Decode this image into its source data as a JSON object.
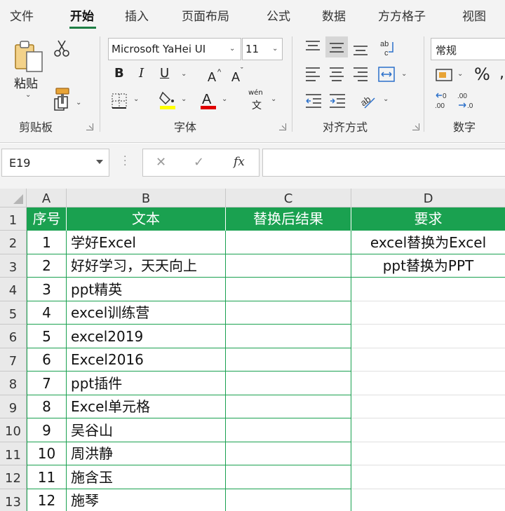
{
  "ribbon": {
    "tabs": [
      "文件",
      "开始",
      "插入",
      "页面布局",
      "公式",
      "数据",
      "方方格子",
      "视图"
    ],
    "active_tab": "开始",
    "groups": {
      "clipboard": "剪贴板",
      "font": "字体",
      "alignment": "对齐方式",
      "number": "数字"
    },
    "paste_label": "粘贴",
    "font_name": "Microsoft YaHei UI",
    "font_size": "11",
    "number_format": "常规",
    "bold": "B",
    "italic": "I",
    "underline": "U",
    "percent": "%",
    "wen_label": "wén",
    "wen_char": "文",
    "accent_color": "#1e7e45",
    "highlight_color": "#ffff00",
    "font_color": "#e00000"
  },
  "formula_bar": {
    "name_box": "E19",
    "fx": "fx",
    "cancel": "✕",
    "enter": "✓",
    "formula": ""
  },
  "sheet": {
    "columns": [
      "A",
      "B",
      "C",
      "D"
    ],
    "rows": [
      "1",
      "2",
      "3",
      "4",
      "5",
      "6",
      "7",
      "8",
      "9",
      "10",
      "11",
      "12",
      "13"
    ],
    "header_row": [
      "序号",
      "文本",
      "替换后结果",
      "要求"
    ],
    "data": [
      {
        "no": "1",
        "text": "学好Excel",
        "result": "",
        "req": "excel替换为Excel"
      },
      {
        "no": "2",
        "text": "好好学习，天天向上",
        "result": "",
        "req": "ppt替换为PPT"
      },
      {
        "no": "3",
        "text": "ppt精英",
        "result": "",
        "req": ""
      },
      {
        "no": "4",
        "text": "excel训练营",
        "result": "",
        "req": ""
      },
      {
        "no": "5",
        "text": "excel2019",
        "result": "",
        "req": ""
      },
      {
        "no": "6",
        "text": "Excel2016",
        "result": "",
        "req": ""
      },
      {
        "no": "7",
        "text": "ppt插件",
        "result": "",
        "req": ""
      },
      {
        "no": "8",
        "text": "Excel单元格",
        "result": "",
        "req": ""
      },
      {
        "no": "9",
        "text": "吴谷山",
        "result": "",
        "req": ""
      },
      {
        "no": "10",
        "text": "周洪静",
        "result": "",
        "req": ""
      },
      {
        "no": "11",
        "text": "施含玉",
        "result": "",
        "req": ""
      },
      {
        "no": "12",
        "text": "施琴",
        "result": "",
        "req": ""
      }
    ],
    "header_fill": "#1aa150",
    "border_color": "#1aa150"
  }
}
